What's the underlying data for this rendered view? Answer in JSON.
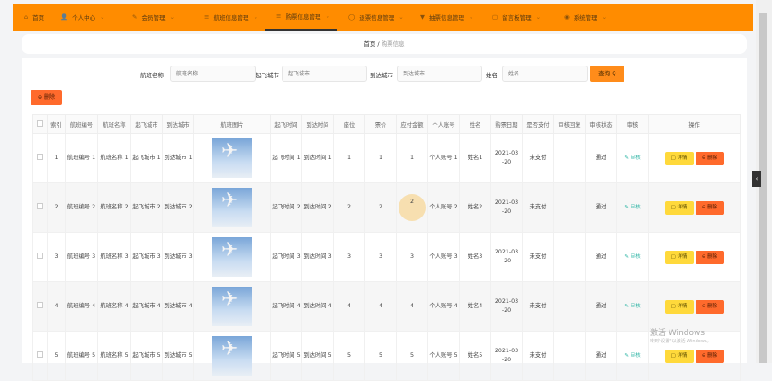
{
  "nav": [
    {
      "icon": "⌂",
      "label": "首页"
    },
    {
      "icon": "👤",
      "label": "个人中心"
    },
    {
      "icon": "✎",
      "label": "会员管理"
    },
    {
      "icon": "≡",
      "label": "航班信息管理"
    },
    {
      "icon": "≡",
      "label": "购票信息管理",
      "active": true
    },
    {
      "icon": "◯",
      "label": "退票信息管理"
    },
    {
      "icon": "▼",
      "label": "抽票信息管理"
    },
    {
      "icon": "▢",
      "label": "留言板管理"
    },
    {
      "icon": "◉",
      "label": "系统管理"
    }
  ],
  "breadcrumb": {
    "home": "首页",
    "sep": "/",
    "current": "购票信息"
  },
  "search": {
    "flight_name_label": "航班名称",
    "flight_name_ph": "航班名称",
    "from_label": "起飞城市",
    "from_ph": "起飞城市",
    "to_label": "到达城市",
    "to_ph": "到达城市",
    "name_label": "姓名",
    "name_ph": "姓名",
    "query": "查询 ⚲"
  },
  "delete_all": "⊖ 删除",
  "columns": [
    "",
    "索引",
    "航班编号",
    "航班名称",
    "起飞城市",
    "到达城市",
    "航班图片",
    "起飞时间",
    "到达时间",
    "座位",
    "票价",
    "应付金额",
    "个人账号",
    "姓名",
    "购票日期",
    "是否支付",
    "审核回复",
    "审核状态",
    "审核",
    "操作"
  ],
  "rows": [
    {
      "idx": "1",
      "no": "航班编号 1",
      "name": "航班名称 1",
      "from": "起飞城市 1",
      "to": "到达城市 1",
      "dep": "起飞时间 1",
      "arr": "到达时间 1",
      "seat": "1",
      "price": "1",
      "amount": "1",
      "account": "个人账号 1",
      "uname": "姓名1",
      "date": "2021-03 -20",
      "paid": "未支付",
      "reply": "",
      "status": "通过"
    },
    {
      "idx": "2",
      "no": "航班编号 2",
      "name": "航班名称 2",
      "from": "起飞城市 2",
      "to": "到达城市 2",
      "dep": "起飞时间 2",
      "arr": "到达时间 2",
      "seat": "2",
      "price": "2",
      "amount": "2",
      "account": "个人账号 2",
      "uname": "姓名2",
      "date": "2021-03 -20",
      "paid": "未支付",
      "reply": "",
      "status": "通过"
    },
    {
      "idx": "3",
      "no": "航班编号 3",
      "name": "航班名称 3",
      "from": "起飞城市 3",
      "to": "到达城市 3",
      "dep": "起飞时间 3",
      "arr": "到达时间 3",
      "seat": "3",
      "price": "3",
      "amount": "3",
      "account": "个人账号 3",
      "uname": "姓名3",
      "date": "2021-03 -20",
      "paid": "未支付",
      "reply": "",
      "status": "通过"
    },
    {
      "idx": "4",
      "no": "航班编号 4",
      "name": "航班名称 4",
      "from": "起飞城市 4",
      "to": "到达城市 4",
      "dep": "起飞时间 4",
      "arr": "到达时间 4",
      "seat": "4",
      "price": "4",
      "amount": "4",
      "account": "个人账号 4",
      "uname": "姓名4",
      "date": "2021-03 -20",
      "paid": "未支付",
      "reply": "",
      "status": "通过"
    },
    {
      "idx": "5",
      "no": "航班编号 5",
      "name": "航班名称 5",
      "from": "起飞城市 5",
      "to": "到达城市 5",
      "dep": "起飞时间 5",
      "arr": "到达时间 5",
      "seat": "5",
      "price": "5",
      "amount": "5",
      "account": "个人账号 5",
      "uname": "姓名5",
      "date": "2021-03 -20",
      "paid": "未支付",
      "reply": "",
      "status": "通过"
    }
  ],
  "audit_label": "✎ 审核",
  "detail_label": "▢ 详情",
  "delete_label": "⊖ 删除",
  "watermark": "激活 Windows",
  "watermark_sub": "转到\"设置\"以激活 Windows。"
}
